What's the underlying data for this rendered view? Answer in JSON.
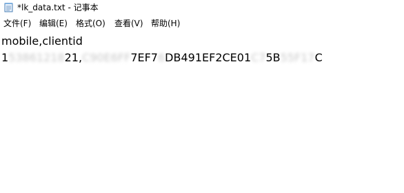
{
  "window": {
    "title": "*lk_data.txt - 记事本"
  },
  "menu": {
    "items": [
      {
        "label": "文件(F)",
        "name": "menu-file"
      },
      {
        "label": "编辑(E)",
        "name": "menu-edit"
      },
      {
        "label": "格式(O)",
        "name": "menu-format"
      },
      {
        "label": "查看(V)",
        "name": "menu-view"
      },
      {
        "label": "帮助(H)",
        "name": "menu-help"
      }
    ]
  },
  "editor": {
    "line1": "mobile,clientid",
    "line2": {
      "part1_visible": "1",
      "part1_blurred": "53861218",
      "part2_visible": "21,",
      "part2_blurred": "C90E6FF",
      "part3_visible": "7EF7",
      "part3_blurred": "6",
      "part4_visible": "DB491EF2CE01",
      "part4_blurred": "C7",
      "part5_visible": "5B",
      "part5_blurred": "55F17",
      "part6_visible": "C"
    }
  }
}
